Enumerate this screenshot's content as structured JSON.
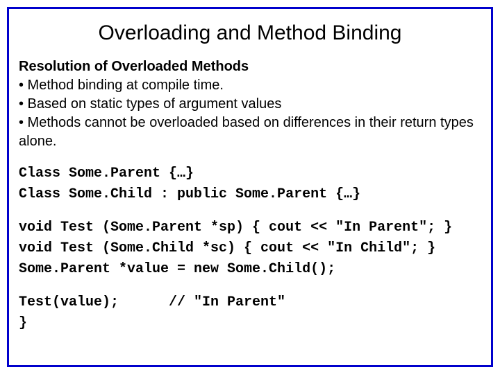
{
  "title": "Overloading and Method Binding",
  "subheading": "Resolution of Overloaded Methods",
  "bullets": [
    "• Method binding at compile time.",
    "• Based on static types of argument values",
    "• Methods cannot be overloaded based on differences in their return types alone."
  ],
  "code_block1": [
    "Class Some.Parent {…}",
    "Class Some.Child : public Some.Parent {…}"
  ],
  "code_block2": [
    "void Test (Some.Parent *sp) { cout << \"In Parent\"; }",
    "void Test (Some.Child *sc) { cout << \"In Child\"; }",
    "Some.Parent *value = new Some.Child();"
  ],
  "code_block3": [
    "Test(value);      // \"In Parent\"",
    "}"
  ]
}
